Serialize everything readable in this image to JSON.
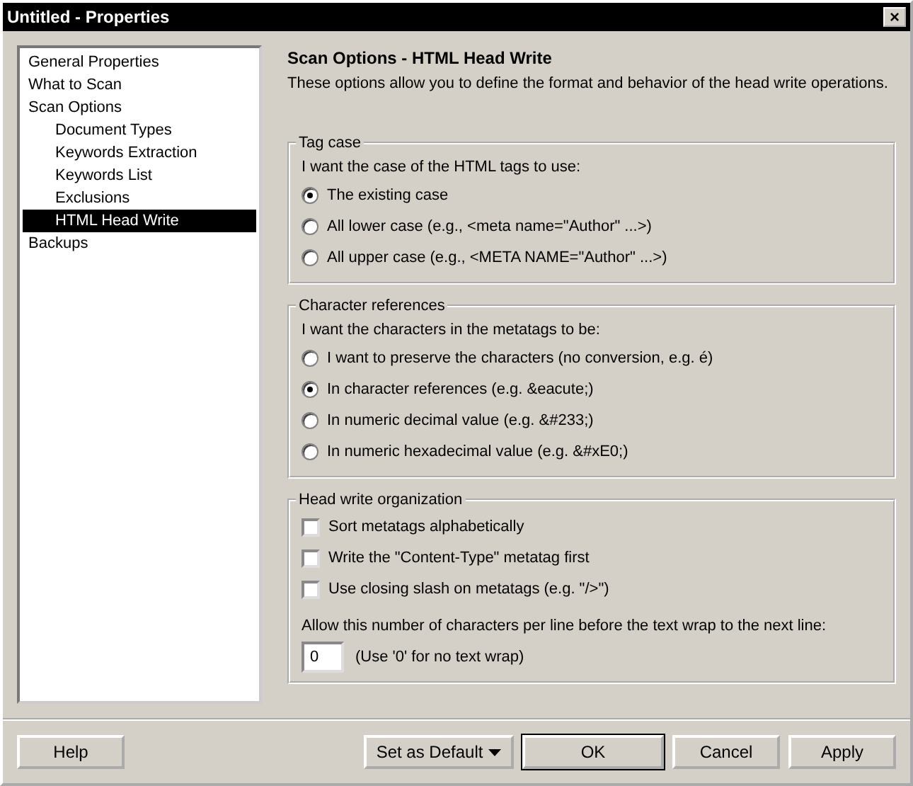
{
  "window": {
    "title": "Untitled - Properties",
    "close": "×"
  },
  "sidebar": {
    "items": [
      {
        "label": "General Properties",
        "selected": false
      },
      {
        "label": "What to Scan",
        "selected": false
      },
      {
        "label": "Scan Options",
        "selected": false,
        "children": [
          {
            "label": "Document Types",
            "selected": false
          },
          {
            "label": "Keywords Extraction",
            "selected": false
          },
          {
            "label": "Keywords List",
            "selected": false
          },
          {
            "label": "Exclusions",
            "selected": false
          },
          {
            "label": "HTML Head Write",
            "selected": true
          }
        ]
      },
      {
        "label": "Backups",
        "selected": false
      }
    ]
  },
  "page": {
    "title": "Scan Options - HTML Head Write",
    "description": "These options allow you to define the format and behavior of the head write operations."
  },
  "groups": [
    {
      "title": "Tag case",
      "prompt": "I want the case of the HTML tags to use:",
      "options": [
        {
          "kind": "radio",
          "label": "The existing case",
          "selected": true
        },
        {
          "kind": "radio",
          "label": "All lower case (e.g., <meta name=\"Author\" ...>)",
          "selected": false
        },
        {
          "kind": "radio",
          "label": "All upper case (e.g., <META NAME=\"Author\" ...>)",
          "selected": false
        }
      ]
    },
    {
      "title": "Character references",
      "prompt": "I want the characters in the metatags to be:",
      "options": [
        {
          "kind": "radio",
          "label": "I want to preserve the characters (no conversion, e.g. é)",
          "selected": false
        },
        {
          "kind": "radio",
          "label": "In character references (e.g. &eacute;)",
          "selected": true
        },
        {
          "kind": "radio",
          "label": "In numeric decimal value (e.g. &#233;)",
          "selected": false
        },
        {
          "kind": "radio",
          "label": "In numeric hexadecimal value (e.g. &#xE0;)",
          "selected": false
        }
      ]
    },
    {
      "title": "Head write organization",
      "options": [
        {
          "kind": "checkbox",
          "label": "Sort metatags alphabetically",
          "checked": false
        },
        {
          "kind": "checkbox",
          "label": "Write the \"Content-Type\" metatag first",
          "checked": false
        },
        {
          "kind": "checkbox",
          "label": "Use closing slash on metatags (e.g. \"/>\")",
          "checked": false
        }
      ],
      "wrap": {
        "label": "Allow this number of characters per line before the text wrap to the next line:",
        "value": "0",
        "hint": "(Use '0' for no text wrap)"
      }
    }
  ],
  "buttons": {
    "help": "Help",
    "set_default": "Set as Default",
    "ok": "OK",
    "cancel": "Cancel",
    "apply": "Apply"
  }
}
